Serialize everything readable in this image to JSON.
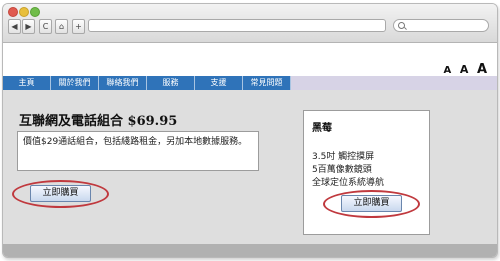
{
  "browser": {
    "back_glyph": "◀",
    "forward_glyph": "▶",
    "reload_glyph": "C",
    "home_glyph": "⌂",
    "bookmark_glyph": "★",
    "add_tab_glyph": "+",
    "url": "",
    "icons": [
      "back-icon",
      "forward-icon",
      "reload-icon",
      "home-icon",
      "bookmark-icon",
      "add-tab-icon",
      "search-icon"
    ]
  },
  "font_size_controls": [
    "A",
    "A",
    "A"
  ],
  "nav": {
    "items": [
      "主頁",
      "關於我們",
      "聯絡我們",
      "服務",
      "支援",
      "常見問題"
    ]
  },
  "offer": {
    "title": "互聯網及電話組合 $69.95",
    "description": "價值$29通話組合，包括綫路租金，另加本地數據服務。",
    "buy_label": "立即購買"
  },
  "product": {
    "name": "黑莓",
    "features": [
      "3.5吋 觸控摸屏",
      "5百萬像數鏡頭",
      "全球定位系統導航"
    ],
    "buy_label": "立即購買"
  },
  "colors": {
    "nav_blue": "#2f73b9",
    "nav_strip": "#d7d3e6",
    "highlight_ring": "#c0393e",
    "content_bg": "#dedede"
  }
}
